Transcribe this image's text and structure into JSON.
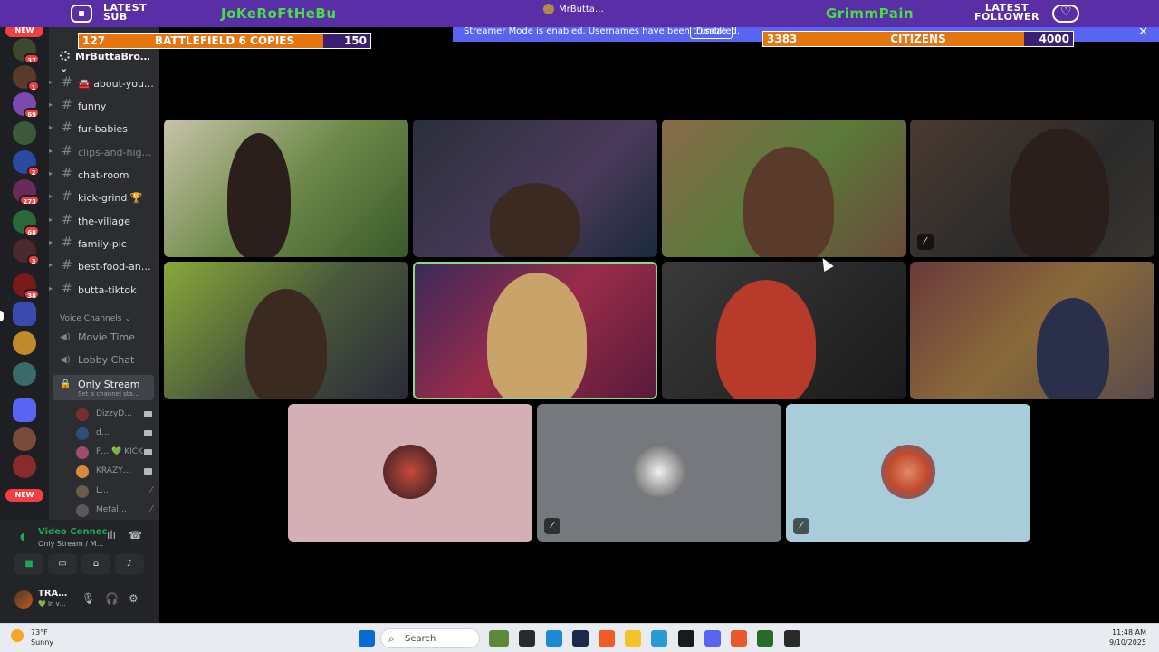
{
  "overlay": {
    "latest_sub_label": "LATEST\nSUB",
    "latest_sub_name": "JoKeRoFtHeBu",
    "latest_follower_label": "LATEST\nFOLLOWER",
    "latest_follower_name": "GrimmPain",
    "center_user": "MrButta…",
    "goal_left": {
      "current": "127",
      "label": "BATTLEFIELD 6 COPIES",
      "target": "150",
      "progress": 0.85
    },
    "goal_right": {
      "current": "3383",
      "label": "CITIZENS",
      "target": "4000",
      "progress": 0.85
    }
  },
  "banner": {
    "text": "Streamer Mode is enabled. Usernames have been truncated.",
    "disable_label": "Disable",
    "close": "✕"
  },
  "rail": {
    "new_label_top": "NEW",
    "new_label_bottom": "NEW",
    "badges": [
      "37",
      "1",
      "69",
      "2",
      "273",
      "68",
      "3",
      "38"
    ]
  },
  "sidebar": {
    "server_name": "MrButtaBro…",
    "text_channels": [
      {
        "name": "🚘 about-you…",
        "muted": false
      },
      {
        "name": "funny",
        "muted": false
      },
      {
        "name": "fur-babies",
        "muted": false
      },
      {
        "name": "clips-and-hig…",
        "muted": true
      },
      {
        "name": "chat-room",
        "muted": false
      },
      {
        "name": "kick-grind 🏆",
        "muted": false
      },
      {
        "name": "the-village",
        "muted": false
      },
      {
        "name": "family-pic",
        "muted": false
      },
      {
        "name": "best-food-an…",
        "muted": false
      },
      {
        "name": "butta-tiktok",
        "muted": false
      }
    ],
    "voice_header": "Voice Channels",
    "voice_channels": [
      {
        "name": "Movie Time"
      },
      {
        "name": "Lobby Chat"
      }
    ],
    "active_voice": {
      "name": "Only Stream",
      "status": "Set a channel sta…"
    },
    "members": [
      {
        "name": "DizzyD…",
        "icon": "camera",
        "color": "#7a2f2f"
      },
      {
        "name": "d…",
        "icon": "camera",
        "color": "#2d4d7a"
      },
      {
        "name": "F… 💚 KICK",
        "icon": "camera",
        "color": "#a34b6b"
      },
      {
        "name": "KRAZY…",
        "icon": "camera",
        "color": "#d88a3a"
      },
      {
        "name": "L…",
        "icon": "mic-off",
        "color": "#6b5b4b"
      },
      {
        "name": "Metal…",
        "icon": "mic-off",
        "color": "#5a5a5a"
      }
    ]
  },
  "voice_panel": {
    "title": "Video Connec",
    "subtitle": "Only Stream / M…",
    "user_name": "TRA…",
    "user_status": "💚 In v…"
  },
  "tiles": [
    {
      "name": "tile-1",
      "bg": "#7c8a5a",
      "person": "#2a1f1a"
    },
    {
      "name": "tile-2",
      "bg": "#3a3046",
      "person": "#3b2a22"
    },
    {
      "name": "tile-3",
      "bg": "#6a5a4a",
      "person": "#5a3a2a"
    },
    {
      "name": "tile-4",
      "bg": "#3d3530",
      "person": "#2a1f1a"
    },
    {
      "name": "tile-5",
      "bg": "#5a6a3a",
      "person": "#3b2a1f"
    },
    {
      "name": "tile-6",
      "bg": "#7a2b4a",
      "person": "#c9a46a",
      "speaking": true
    },
    {
      "name": "tile-7",
      "bg": "#2a2a2a",
      "person": "#b83a2a"
    },
    {
      "name": "tile-8",
      "bg": "#6a4a3a",
      "person": "#2a2f4a"
    },
    {
      "name": "tile-9",
      "bg": "#d4b0b6",
      "avatar": "#8a2a2a"
    },
    {
      "name": "tile-10",
      "bg": "#75787c",
      "avatar": "#e6e6e6",
      "muted": true
    },
    {
      "name": "tile-11",
      "bg": "#a8ccd8",
      "avatar": "#c24a2a",
      "muted": true
    }
  ],
  "taskbar": {
    "temp": "73°F",
    "weather": "Sunny",
    "search": "Search",
    "time": "11:48 AM",
    "date": "9/10/2025"
  }
}
